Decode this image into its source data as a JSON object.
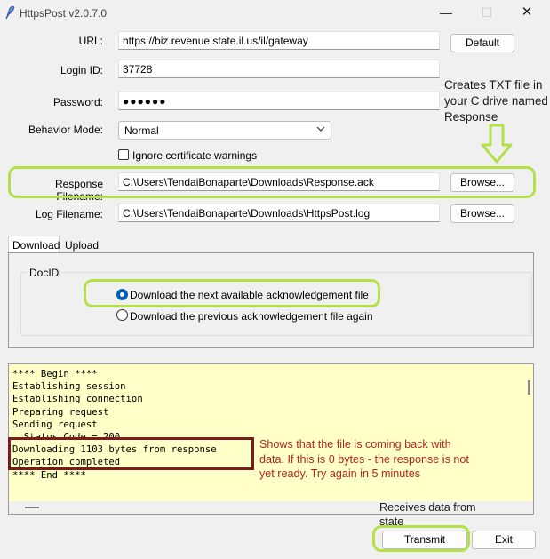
{
  "window": {
    "title": "HttpsPost v2.0.7.0",
    "controls": {
      "minimize": "—",
      "maximize": "☐",
      "close": "✕"
    }
  },
  "form": {
    "url_label": "URL:",
    "url_value": "https://biz.revenue.state.il.us/il/gateway",
    "default_button": "Default",
    "login_label": "Login ID:",
    "login_value": "37728",
    "password_label": "Password:",
    "password_value": "●●●●●●",
    "behavior_label": "Behavior Mode:",
    "behavior_value": "Normal",
    "ignore_cert_label": "Ignore certificate warnings",
    "ignore_cert_checked": false,
    "response_label": "Response Filename:",
    "response_value": "C:\\Users\\TendaiBonaparte\\Downloads\\Response.ack",
    "log_label": "Log Filename:",
    "log_value": "C:\\Users\\TendaiBonaparte\\Downloads\\HttpsPost.log",
    "browse_label": "Browse..."
  },
  "tabs": [
    {
      "label": "Download",
      "active": true
    },
    {
      "label": "Upload",
      "active": false
    }
  ],
  "docid": {
    "group_label": "DocID",
    "options": [
      {
        "label": "Download the next available acknowledgement file",
        "selected": true
      },
      {
        "label": "Download the previous acknowledgement file again",
        "selected": false
      }
    ]
  },
  "log": {
    "lines": [
      "**** Begin ****",
      "Establishing session",
      "Establishing connection",
      "Preparing request",
      "Sending request",
      "  Status Code = 200",
      "Downloading 1103 bytes from response",
      "Operation completed",
      "**** End ****"
    ]
  },
  "footer": {
    "transmit_label": "Transmit",
    "exit_label": "Exit"
  },
  "annotations": {
    "response_note": [
      "Creates TXT file in",
      "your C drive named",
      "Response"
    ],
    "bytes_note": [
      "Shows that the file is coming back with",
      "data. If this is 0 bytes - the response is not",
      "yet ready. Try again in 5 minutes"
    ],
    "receives_note": [
      "Receives data from",
      "state"
    ]
  },
  "colors": {
    "highlight_green": "#b4e04a",
    "highlight_red": "#7b1b1b",
    "note_red": "#b3261e",
    "log_background": "#ffffc8",
    "radio_accent": "#005fb8"
  }
}
